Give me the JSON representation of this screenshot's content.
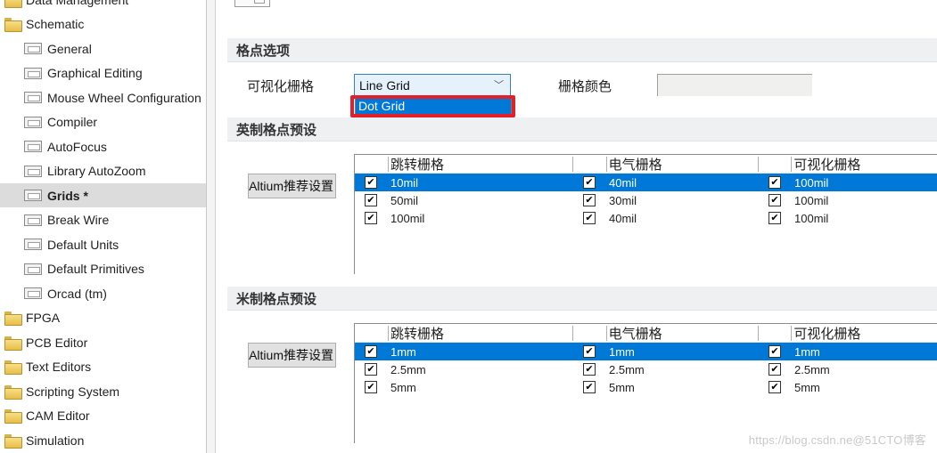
{
  "sidebar": {
    "items": [
      {
        "label": "Data Management",
        "type": "folder",
        "state": "closed"
      },
      {
        "label": "Schematic",
        "type": "folder",
        "state": "open"
      },
      {
        "label": "General",
        "type": "page"
      },
      {
        "label": "Graphical Editing",
        "type": "page"
      },
      {
        "label": "Mouse Wheel Configuration",
        "type": "page"
      },
      {
        "label": "Compiler",
        "type": "page"
      },
      {
        "label": "AutoFocus",
        "type": "page"
      },
      {
        "label": "Library AutoZoom",
        "type": "page"
      },
      {
        "label": "Grids *",
        "type": "page",
        "selected": true
      },
      {
        "label": "Break Wire",
        "type": "page"
      },
      {
        "label": "Default Units",
        "type": "page"
      },
      {
        "label": "Default Primitives",
        "type": "page"
      },
      {
        "label": "Orcad (tm)",
        "type": "page"
      },
      {
        "label": "FPGA",
        "type": "folder",
        "state": "closed"
      },
      {
        "label": "PCB Editor",
        "type": "folder",
        "state": "closed"
      },
      {
        "label": "Text Editors",
        "type": "folder",
        "state": "closed"
      },
      {
        "label": "Scripting System",
        "type": "folder",
        "state": "closed"
      },
      {
        "label": "CAM Editor",
        "type": "folder",
        "state": "closed"
      },
      {
        "label": "Simulation",
        "type": "folder",
        "state": "closed"
      }
    ]
  },
  "grid_options": {
    "section_title": "格点选项",
    "visible_grid_label": "可视化栅格",
    "visible_grid_value": "Line Grid",
    "dropdown_options": [
      "Dot Grid",
      "Line Grid"
    ],
    "highlighted_option": "Dot Grid",
    "grid_color_label": "栅格颜色",
    "grid_color_value": "#f0f0ee"
  },
  "imperial": {
    "section_title": "英制格点预设",
    "preset_button": "Altium推荐设置",
    "columns": [
      "跳转栅格",
      "电气栅格",
      "可视化栅格"
    ],
    "rows": [
      {
        "selected": true,
        "snap": "10mil",
        "snap_on": true,
        "electrical": "40mil",
        "electrical_on": true,
        "visible": "100mil",
        "visible_on": true
      },
      {
        "selected": false,
        "snap": "50mil",
        "snap_on": true,
        "electrical": "30mil",
        "electrical_on": true,
        "visible": "100mil",
        "visible_on": true
      },
      {
        "selected": false,
        "snap": "100mil",
        "snap_on": true,
        "electrical": "40mil",
        "electrical_on": true,
        "visible": "100mil",
        "visible_on": true
      }
    ]
  },
  "metric": {
    "section_title": "米制格点预设",
    "preset_button": "Altium推荐设置",
    "columns": [
      "跳转栅格",
      "电气栅格",
      "可视化栅格"
    ],
    "rows": [
      {
        "selected": true,
        "snap": "1mm",
        "snap_on": true,
        "electrical": "1mm",
        "electrical_on": true,
        "visible": "1mm",
        "visible_on": true
      },
      {
        "selected": false,
        "snap": "2.5mm",
        "snap_on": true,
        "electrical": "2.5mm",
        "electrical_on": true,
        "visible": "2.5mm",
        "visible_on": true
      },
      {
        "selected": false,
        "snap": "5mm",
        "snap_on": true,
        "electrical": "5mm",
        "electrical_on": true,
        "visible": "5mm",
        "visible_on": true
      }
    ]
  },
  "watermark": "https://blog.csdn.ne@51CTO博客",
  "colors": {
    "selection": "#0078d7",
    "highlight_box": "#e3202a",
    "section_bg": "#eff0f2"
  },
  "icons": {
    "check": "✔",
    "chevron": "﹀"
  }
}
